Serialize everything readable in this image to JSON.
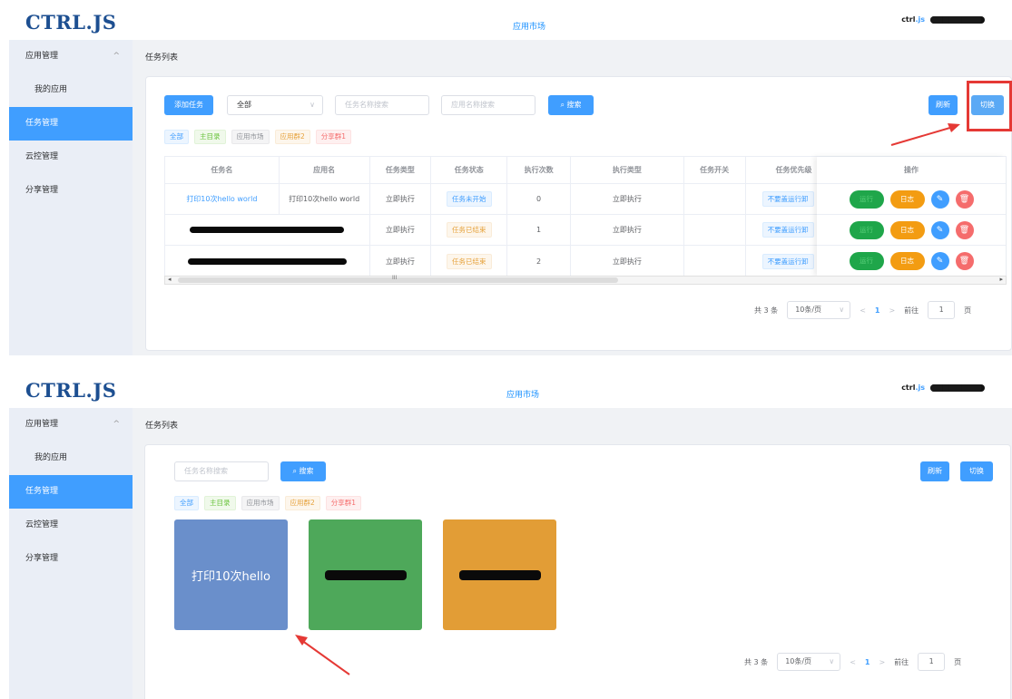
{
  "app": {
    "logo": "CTRL.JS",
    "nav_market": "应用市场",
    "user_logo_a": "ctrl",
    "user_logo_b": ".js",
    "user_name": "████████"
  },
  "sidebar": {
    "items": [
      {
        "label": "应用管理",
        "chevron": "^"
      },
      {
        "label": "我的应用"
      },
      {
        "label": "任务管理"
      },
      {
        "label": "云控管理"
      },
      {
        "label": "分享管理"
      }
    ]
  },
  "breadcrumb": "任务列表",
  "toolbar": {
    "add_task": "添加任务",
    "select_value": "全部",
    "task_search_placeholder": "任务名称搜索",
    "app_search_placeholder": "应用名称搜索",
    "search": "搜索",
    "refresh": "刷新",
    "switch": "切换"
  },
  "tags": [
    "全部",
    "主目录",
    "应用市场",
    "应用群2",
    "分享群1"
  ],
  "table": {
    "headers": [
      "任务名",
      "应用名",
      "任务类型",
      "任务状态",
      "执行次数",
      "执行类型",
      "任务开关",
      "任务优先级",
      "操作"
    ],
    "rows": [
      {
        "task": "打印10次hello world",
        "app": "打印10次hello world",
        "type": "立即执行",
        "status": "任务未开始",
        "count": "0",
        "exec": "立即执行",
        "prio": "不要盖运行卸"
      },
      {
        "type": "立即执行",
        "status": "任务已结束",
        "count": "1",
        "exec": "立即执行",
        "prio": "不要盖运行卸"
      },
      {
        "type": "立即执行",
        "status": "任务已结束",
        "count": "2",
        "exec": "立即执行",
        "prio": "不要盖运行卸"
      }
    ],
    "ops": {
      "run": "运行",
      "log": "日志",
      "edit_icon": "✎",
      "delete_icon": "🗑"
    }
  },
  "scroll_mid": "III",
  "pager": {
    "total": "共 3 条",
    "size": "10条/页",
    "prev": "<",
    "page": "1",
    "next": ">",
    "goto": "前往",
    "goto_value": "1",
    "unit": "页"
  },
  "tiles": [
    {
      "label": "打印10次hello",
      "color": "#6a8fcb"
    },
    {
      "label": "",
      "color": "#4ea85a"
    },
    {
      "label": "",
      "color": "#e29d36"
    }
  ],
  "colors": {
    "primary": "#409eff",
    "sidebar_bg": "#eaeef6",
    "annotation": "#e53935"
  }
}
